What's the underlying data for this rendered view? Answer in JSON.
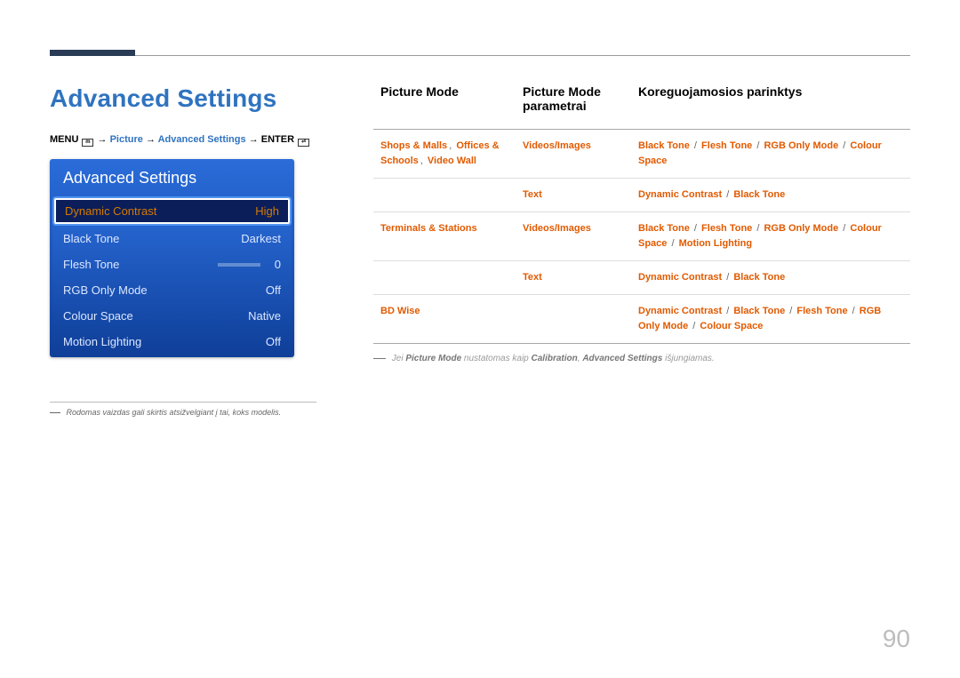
{
  "page_number": "90",
  "section_title": "Advanced Settings",
  "menupath": {
    "pre": "MENU",
    "picture": "Picture",
    "advanced": "Advanced Settings",
    "enter": "ENTER",
    "arrow": "→"
  },
  "osd": {
    "title": "Advanced Settings",
    "rows": [
      {
        "label": "Dynamic Contrast",
        "value": "High",
        "selected": true
      },
      {
        "label": "Black Tone",
        "value": "Darkest"
      },
      {
        "label": "Flesh Tone",
        "value": "0",
        "slider": true
      },
      {
        "label": "RGB Only Mode",
        "value": "Off"
      },
      {
        "label": "Colour Space",
        "value": "Native"
      },
      {
        "label": "Motion Lighting",
        "value": "Off"
      }
    ]
  },
  "left_footnote": "Rodomas vaizdas gali skirtis atsižvelgiant į tai, koks modelis.",
  "table": {
    "headers": [
      "Picture Mode",
      "Picture Mode parametrai",
      "Koreguojamosios parinktys"
    ],
    "rows": [
      {
        "c1_parts": [
          "Shops & Malls",
          "Offices & Schools",
          "Video Wall"
        ],
        "c1_joins": [
          ", ",
          ", "
        ],
        "c2": "Videos/Images",
        "c3_parts": [
          "Black Tone",
          "Flesh Tone",
          "RGB Only Mode",
          "Colour Space"
        ]
      },
      {
        "c1_parts": [],
        "c2": "Text",
        "c3_parts": [
          "Dynamic Contrast",
          "Black Tone"
        ]
      },
      {
        "c1_parts": [
          "Terminals & Stations"
        ],
        "c2": "Videos/Images",
        "c3_parts": [
          "Black Tone",
          "Flesh Tone",
          "RGB Only Mode",
          "Colour Space",
          "Motion Lighting"
        ]
      },
      {
        "c1_parts": [],
        "c2": "Text",
        "c3_parts": [
          "Dynamic Contrast",
          "Black Tone"
        ]
      },
      {
        "c1_parts": [
          "BD Wise"
        ],
        "c2": "",
        "c3_parts": [
          "Dynamic Contrast",
          "Black Tone",
          "Flesh Tone",
          "RGB Only Mode",
          "Colour Space"
        ]
      }
    ]
  },
  "right_note": {
    "pre": "Jei ",
    "b1": "Picture Mode",
    "mid1": " nustatomas kaip ",
    "b2": "Calibration",
    "mid2": ", ",
    "b3": "Advanced Settings",
    "post": " išjungiamas."
  }
}
